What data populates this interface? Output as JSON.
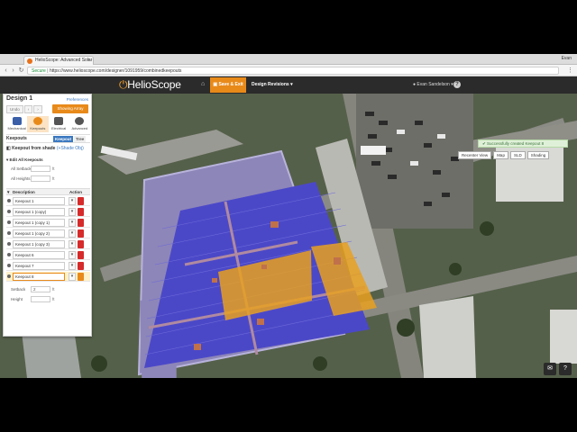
{
  "browser": {
    "tab_title": "HelioScope: Advanced Solar",
    "user": "Evan",
    "secure_label": "Secure",
    "url": "https://www.helioscope.com/designer/1091959/combinedkeepouts"
  },
  "header": {
    "logo": "HelioScope",
    "save_label": "Save & Exit",
    "design_revisions_label": "Design Revisions",
    "account_label": "Evan Sandelson"
  },
  "panel": {
    "title": "Design 1",
    "preferences_label": "Preferences",
    "undo_label": "Undo",
    "showing_array_label": "Showing Array",
    "modes": [
      {
        "label": "Mechanical",
        "icon": "grid-icon",
        "color": "#3a5ea8"
      },
      {
        "label": "Keepouts",
        "icon": "keepout-icon",
        "color": "#e88a1a"
      },
      {
        "label": "Electrical",
        "icon": "electrical-icon",
        "color": "#555555"
      },
      {
        "label": "Advanced",
        "icon": "plus-icon",
        "color": "#555555"
      }
    ],
    "section_title": "Keepouts",
    "keepout_tab": "Keepout",
    "tree_tab": "Tree",
    "from_shade_prefix": "Keepout from shade",
    "from_shade_link": "(+Shade Obj)",
    "edit_all_label": "Edit All Keepouts",
    "all_setback_label": "All Setback",
    "all_setback_unit": "ft",
    "all_heights_label": "All Heights",
    "all_heights_unit": "ft",
    "col_description": "Description",
    "col_action": "Action",
    "keepouts": [
      "Keepout 1",
      "Keepout 1 (copy)",
      "Keepout 1 (copy 1)",
      "Keepout 1 (copy 2)",
      "Keepout 1 (copy 3)",
      "Keepout 6",
      "Keepout 7",
      "Keepout 8"
    ],
    "selected_setback_label": "Setback",
    "selected_setback_value": "2",
    "selected_setback_unit": "ft",
    "selected_height_label": "Height",
    "selected_height_unit": "ft"
  },
  "notifications": {
    "toast": "Successfully created Keepout 8"
  },
  "map_controls": [
    "Recenter View",
    "Map",
    "SLD",
    "Shading"
  ],
  "colors": {
    "accent": "#e88a1a",
    "link": "#3a78c0",
    "panel_blue": "#4b48c8",
    "keepout_fill": "#e8a020"
  }
}
